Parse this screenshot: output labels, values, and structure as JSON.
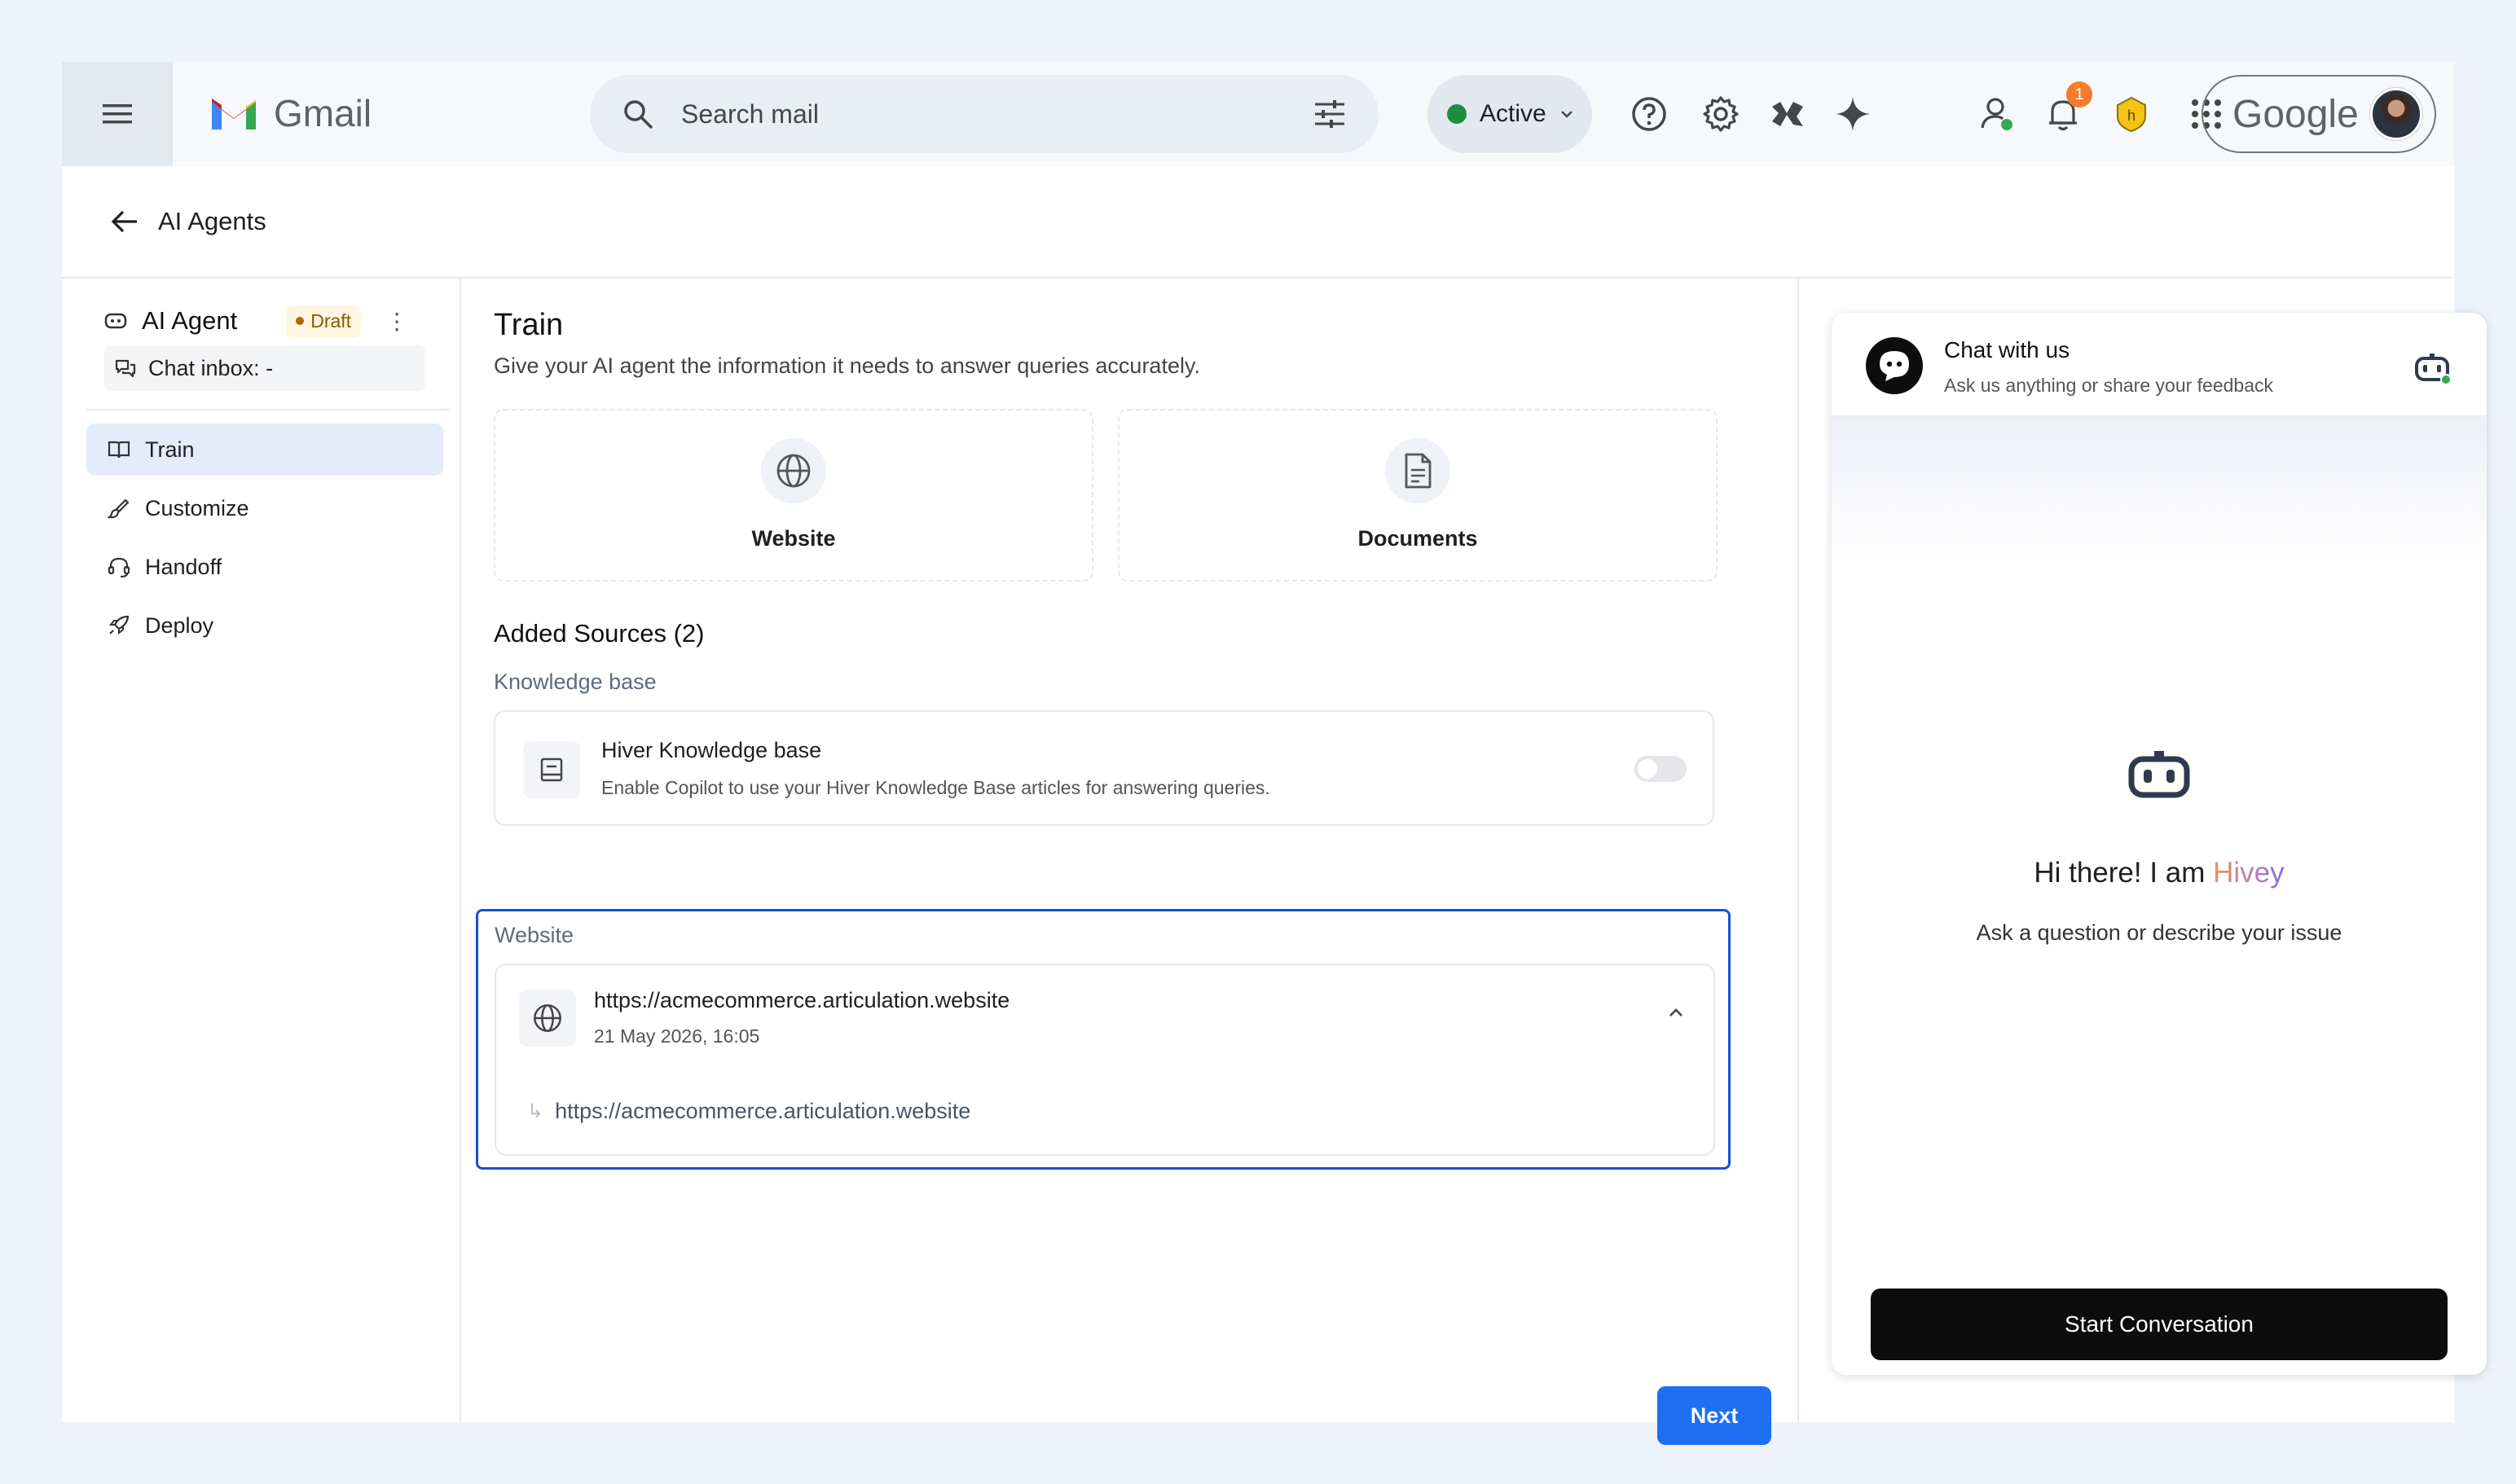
{
  "topbar": {
    "app_name": "Gmail",
    "search_placeholder": "Search mail",
    "status_label": "Active",
    "notification_count": "1",
    "account_word": "Google"
  },
  "page": {
    "title": "AI Agents"
  },
  "agent": {
    "name": "AI Agent",
    "badge": "Draft",
    "inbox": "Chat inbox: -"
  },
  "nav": {
    "items": [
      {
        "label": "Train",
        "icon": "book-open-icon",
        "active": true
      },
      {
        "label": "Customize",
        "icon": "brush-icon",
        "active": false
      },
      {
        "label": "Handoff",
        "icon": "headset-icon",
        "active": false
      },
      {
        "label": "Deploy",
        "icon": "rocket-icon",
        "active": false
      }
    ]
  },
  "train": {
    "title": "Train",
    "subtitle": "Give your AI agent the information it needs to answer queries accurately.",
    "sources": [
      {
        "label": "Website",
        "icon": "globe-icon"
      },
      {
        "label": "Documents",
        "icon": "document-icon"
      }
    ],
    "added_sources_title": "Added Sources (2)",
    "knowledge_base_label": "Knowledge base",
    "kb_name": "Hiver Knowledge base",
    "kb_description": "Enable Copilot to use your Hiver Knowledge Base articles for answering queries.",
    "kb_enabled": false,
    "website_label": "Website",
    "website_url": "https://acmecommerce.articulation.website",
    "website_date": "21 May 2026, 16:05",
    "website_subpage": "https://acmecommerce.articulation.website",
    "next_label": "Next"
  },
  "chat": {
    "title": "Chat with us",
    "subtitle": "Ask us anything or share your feedback",
    "greeting_prefix": "Hi there! I am ",
    "greeting_name": "Hivey",
    "prompt": "Ask a question or describe your issue",
    "start_label": "Start Conversation"
  },
  "colors": {
    "accent": "#1e6ff1",
    "selected_border": "#1a4fd8",
    "status_green": "#1e8e3e",
    "nav_active_bg": "#e4ecfb"
  }
}
